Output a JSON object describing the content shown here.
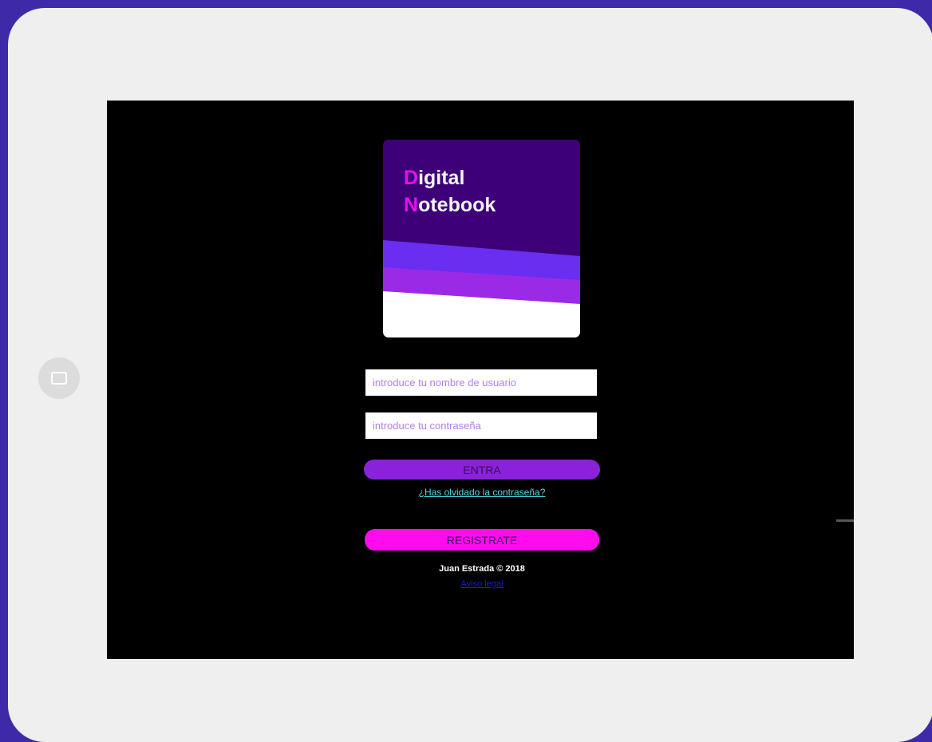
{
  "logo": {
    "line1_initial": "D",
    "line1_rest": "igital",
    "line2_initial": "N",
    "line2_rest": "otebook"
  },
  "login": {
    "username_placeholder": "introduce tu nombre de usuario",
    "password_placeholder": "introduce tu contraseña",
    "submit_label": "ENTRA",
    "forgot_link": "¿Has olvidado la contraseña?",
    "register_label": "REGISTRATE"
  },
  "footer": {
    "copyright": "Juan Estrada © 2018",
    "link": "Aviso legal"
  },
  "colors": {
    "frame_background": "#3e2aa8",
    "logo_background": "#3d0079",
    "logo_accent": "#e60ff0",
    "entra_button": "#8a22dc",
    "register_button": "#ff0bee",
    "forgot_link": "#4dd9e3"
  },
  "icons": {
    "home_button": "home-button-icon"
  }
}
